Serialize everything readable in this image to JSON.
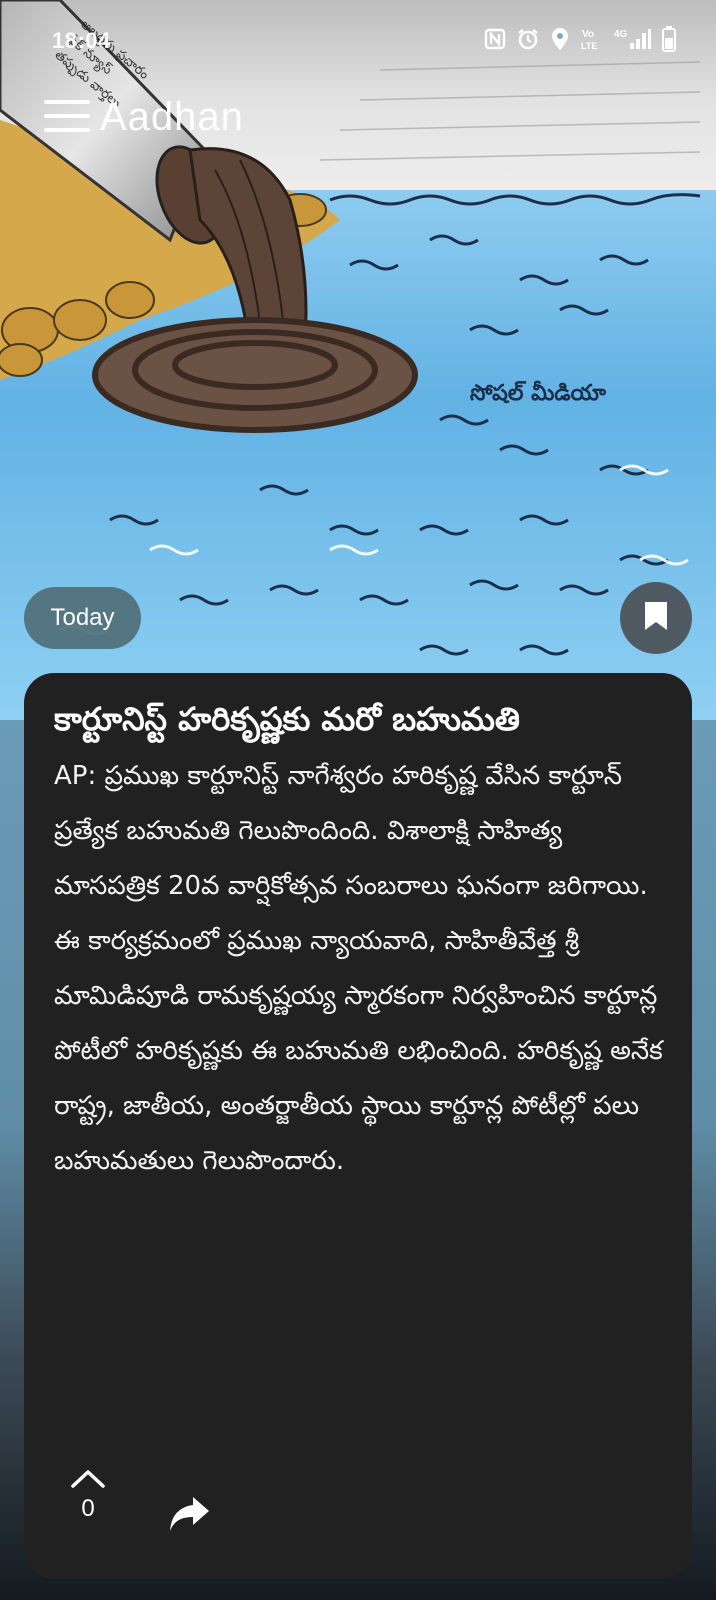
{
  "status_bar": {
    "time": "18:04",
    "icons": [
      "nfc-icon",
      "alarm-icon",
      "location-icon",
      "volte-icon",
      "signal-4g-icon",
      "battery-icon"
    ],
    "network_label": "4G",
    "volte_label": "Vo LTE"
  },
  "app_bar": {
    "logo_text": "Aadhan",
    "menu_icon": "hamburger-menu-icon"
  },
  "hero_image": {
    "cartoon_caption": "సోషల్ మీడియా"
  },
  "chip": {
    "label": "Today"
  },
  "article": {
    "title": "కార్టూనిస్ట్ హరికృష్ణకు మరో బహుమతి",
    "body": "AP: ప్రముఖ కార్టూనిస్ట్ నాగేశ్వరం హరికృష్ణ వేసిన కార్టూన్ ప్రత్యేక బహుమతి గెలుపొందింది. విశాలాక్షి సాహిత్య మాసపత్రిక 20వ వార్షికోత్సవ సంబరాలు ఘనంగా జరిగాయి. ఈ కార్యక్రమంలో ప్రముఖ న్యాయవాది, సాహితీవేత్త శ్రీ మామిడిపూడి రామకృష్ణయ్య స్మారకంగా నిర్వహించిన కార్టూన్ల పోటీలో హరికృష్ణకు ఈ బహుమతి లభించింది. హరికృష్ణ అనేక రాష్ట్ర, జాతీయ, అంతర్జాతీయ స్థాయి కార్టూన్ల పోటీల్లో పలు బహుమతులు గెలుపొందారు."
  },
  "actions": {
    "upvote_count": "0",
    "upvote_icon": "chevron-up-icon",
    "share_icon": "share-arrow-icon",
    "bookmark_icon": "bookmark-icon"
  },
  "colors": {
    "card_background": "#212121",
    "chip_background": "#506e78",
    "sky": "#e8e8e8",
    "water": "#6fb8e6"
  }
}
